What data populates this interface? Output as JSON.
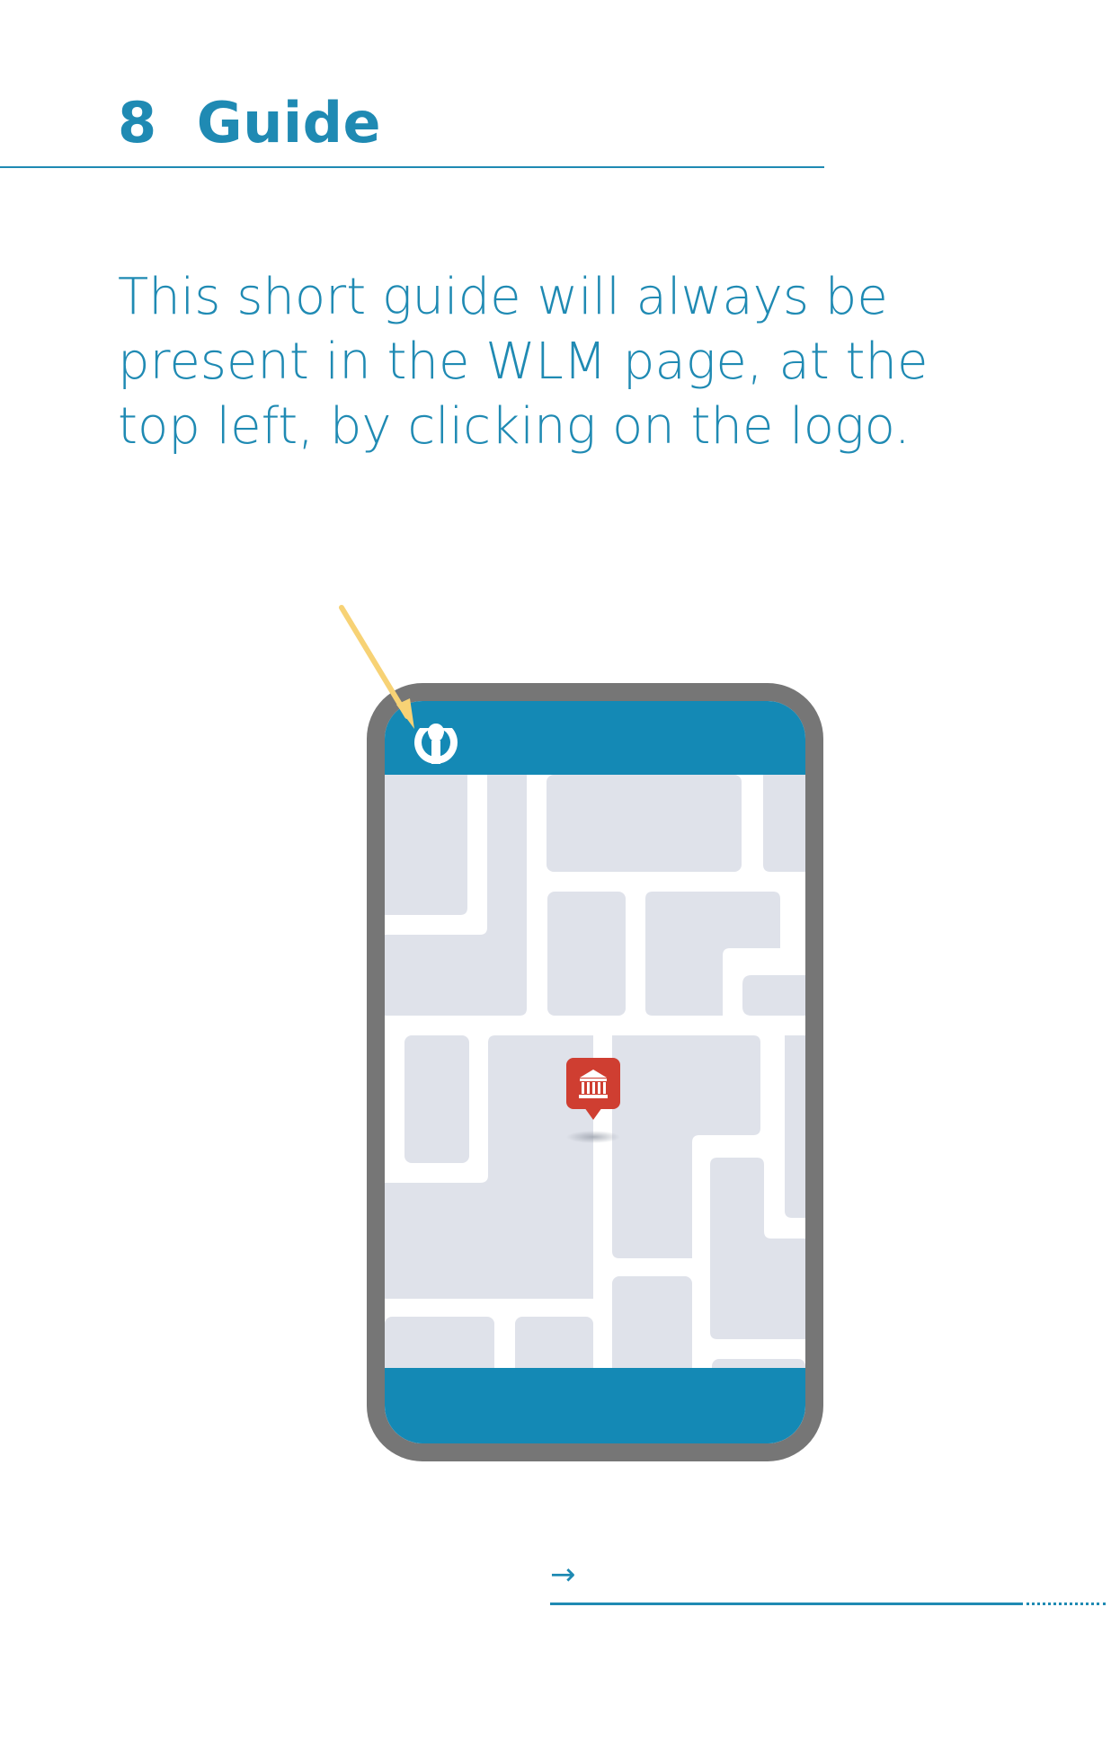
{
  "section": {
    "title": "8  Guide"
  },
  "intro_text": "This short guide will always be present in the WLM page, at the top left, by clicking on the logo.",
  "illustration": {
    "phone_frame_icon": "smartphone-icon",
    "logo_icon": "wikimedia-logo-icon",
    "pointer_icon": "arrow-pointer-icon",
    "map_marker_icon": "monument-pin-icon",
    "colors": {
      "frame": "#767676",
      "header": "#1489b5",
      "map_block": "#dfe2ea",
      "road": "#ffffff",
      "pin": "#cf3e31",
      "pointer": "#f7d275"
    }
  },
  "footer": {
    "next_icon": "→"
  }
}
